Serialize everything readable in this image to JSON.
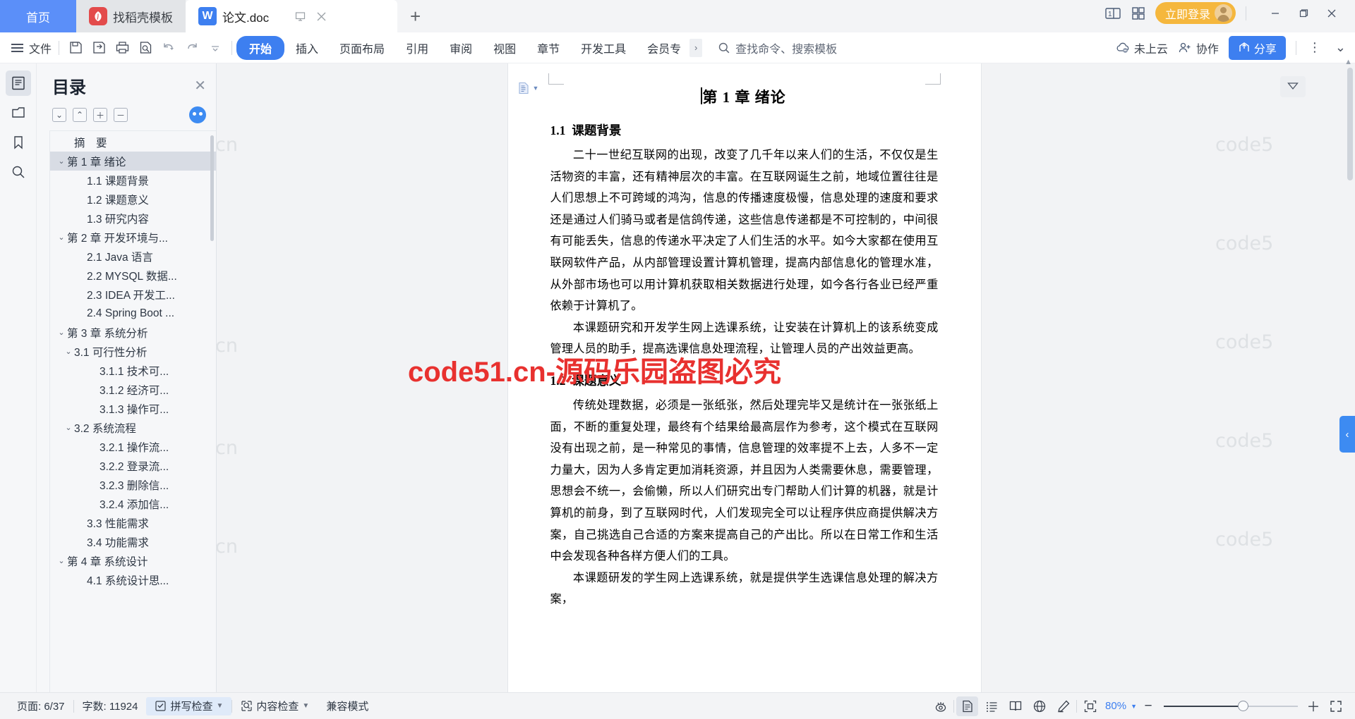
{
  "titlebar": {
    "tabs": [
      {
        "label": "首页",
        "icon": "home-tab",
        "type": "home"
      },
      {
        "label": "找稻壳模板",
        "icon": "docer-icon",
        "type": "template"
      },
      {
        "label": "论文.doc",
        "icon": "wps-writer-icon",
        "type": "document"
      }
    ],
    "new_tab": "+",
    "login_label": "立即登录",
    "icons": [
      "split-screen-icon",
      "app-grid-icon",
      "minimize-icon",
      "maximize-icon",
      "close-icon"
    ]
  },
  "ribbon": {
    "file_label": "文件",
    "quick_access": [
      "save-icon",
      "save-as-cloud-icon",
      "print-icon",
      "print-preview-icon",
      "undo-icon",
      "redo-icon",
      "customize-qat-icon"
    ],
    "tabs": [
      {
        "label": "开始",
        "active": true
      },
      {
        "label": "插入",
        "active": false
      },
      {
        "label": "页面布局",
        "active": false
      },
      {
        "label": "引用",
        "active": false
      },
      {
        "label": "审阅",
        "active": false
      },
      {
        "label": "视图",
        "active": false
      },
      {
        "label": "章节",
        "active": false
      },
      {
        "label": "开发工具",
        "active": false
      },
      {
        "label": "会员专",
        "active": false
      }
    ],
    "more_tabs": "›",
    "search_placeholder": "查找命令、搜索模板",
    "cloud_status": "未上云",
    "collab_label": "协作",
    "share_label": "分享",
    "overflow": "⋮",
    "collapse": "⌄"
  },
  "rail": {
    "items": [
      {
        "name": "outline-panel",
        "icon": "document-outline-icon",
        "active": true
      },
      {
        "name": "file-panel",
        "icon": "folder-icon",
        "active": false
      },
      {
        "name": "bookmark-panel",
        "icon": "bookmark-icon",
        "active": false
      },
      {
        "name": "search-panel",
        "icon": "search-icon",
        "active": false
      }
    ]
  },
  "outline": {
    "title": "目录",
    "close": "✕",
    "tools": [
      {
        "name": "expand-all",
        "glyph": "⌄"
      },
      {
        "name": "collapse-all",
        "glyph": "⌃"
      },
      {
        "name": "increase-level",
        "glyph": "＋"
      },
      {
        "name": "decrease-level",
        "glyph": "－"
      }
    ],
    "items": [
      {
        "label": "摘　要",
        "indent": 1,
        "caret": "",
        "selected": false
      },
      {
        "label": "第 1 章 绪论",
        "indent": 0,
        "caret": "⌄",
        "selected": true
      },
      {
        "label": "1.1 课题背景",
        "indent": 2,
        "caret": "",
        "selected": false
      },
      {
        "label": "1.2 课题意义",
        "indent": 2,
        "caret": "",
        "selected": false
      },
      {
        "label": "1.3 研究内容",
        "indent": 2,
        "caret": "",
        "selected": false
      },
      {
        "label": "第 2 章 开发环境与...",
        "indent": 0,
        "caret": "⌄",
        "selected": false
      },
      {
        "label": "2.1 Java 语言",
        "indent": 2,
        "caret": "",
        "selected": false
      },
      {
        "label": "2.2 MYSQL 数据...",
        "indent": 2,
        "caret": "",
        "selected": false
      },
      {
        "label": "2.3 IDEA 开发工...",
        "indent": 2,
        "caret": "",
        "selected": false
      },
      {
        "label": "2.4 Spring Boot ...",
        "indent": 2,
        "caret": "",
        "selected": false
      },
      {
        "label": "第 3 章 系统分析",
        "indent": 0,
        "caret": "⌄",
        "selected": false
      },
      {
        "label": "3.1 可行性分析",
        "indent": 1,
        "caret": "⌄",
        "selected": false
      },
      {
        "label": "3.1.1 技术可...",
        "indent": 3,
        "caret": "",
        "selected": false
      },
      {
        "label": "3.1.2 经济可...",
        "indent": 3,
        "caret": "",
        "selected": false
      },
      {
        "label": "3.1.3 操作可...",
        "indent": 3,
        "caret": "",
        "selected": false
      },
      {
        "label": "3.2 系统流程",
        "indent": 1,
        "caret": "⌄",
        "selected": false
      },
      {
        "label": "3.2.1 操作流...",
        "indent": 3,
        "caret": "",
        "selected": false
      },
      {
        "label": "3.2.2 登录流...",
        "indent": 3,
        "caret": "",
        "selected": false
      },
      {
        "label": "3.2.3 删除信...",
        "indent": 3,
        "caret": "",
        "selected": false
      },
      {
        "label": "3.2.4 添加信...",
        "indent": 3,
        "caret": "",
        "selected": false
      },
      {
        "label": "3.3 性能需求",
        "indent": 2,
        "caret": "",
        "selected": false
      },
      {
        "label": "3.4 功能需求",
        "indent": 2,
        "caret": "",
        "selected": false
      },
      {
        "label": "第 4 章 系统设计",
        "indent": 0,
        "caret": "⌄",
        "selected": false
      },
      {
        "label": "4.1 系统设计思...",
        "indent": 2,
        "caret": "",
        "selected": false
      }
    ]
  },
  "document": {
    "chapter_title": "第 1 章 绪论",
    "sections": [
      {
        "heading_num": "1.1",
        "heading_text": "课题背景",
        "paragraphs": [
          "二十一世纪互联网的出现，改变了几千年以来人们的生活，不仅仅是生活物资的丰富，还有精神层次的丰富。在互联网诞生之前，地域位置往往是人们思想上不可跨域的鸿沟，信息的传播速度极慢，信息处理的速度和要求还是通过人们骑马或者是信鸽传递，这些信息传递都是不可控制的，中间很有可能丢失，信息的传递水平决定了人们生活的水平。如今大家都在使用互联网软件产品，从内部管理设置计算机管理，提高内部信息化的管理水准，从外部市场也可以用计算机获取相关数据进行处理，如今各行各业已经严重依赖于计算机了。",
          "本课题研究和开发学生网上选课系统，让安装在计算机上的该系统变成管理人员的助手，提高选课信息处理流程，让管理人员的产出效益更高。"
        ]
      },
      {
        "heading_num": "1.2",
        "heading_text": "课题意义",
        "paragraphs": [
          "传统处理数据，必须是一张纸张，然后处理完毕又是统计在一张张纸上面，不断的重复处理，最终有个结果给最高层作为参考，这个模式在互联网没有出现之前，是一种常见的事情，信息管理的效率提不上去，人多不一定力量大，因为人多肯定更加消耗资源，并且因为人类需要休息，需要管理，思想会不统一，会偷懒，所以人们研究出专门帮助人们计算的机器，就是计算机的前身，到了互联网时代，人们发现完全可以让程序供应商提供解决方案，自己挑选自己合适的方案来提高自己的产出比。所以在日常工作和生活中会发现各种各样方便人们的工具。",
          "本课题研发的学生网上选课系统，就是提供学生选课信息处理的解决方案，"
        ]
      }
    ]
  },
  "watermarks": {
    "text": "code51.cn",
    "red_banner": "code51.cn-源码乐园盗图必究",
    "red_color": "#e8312f"
  },
  "statusbar": {
    "page_label": "页面: 6/37",
    "word_count_label": "字数: 11924",
    "spell_check": "拼写检查",
    "content_check": "内容检查",
    "compat_mode": "兼容模式",
    "view_icons": [
      {
        "name": "focus-read-icon",
        "active": false
      },
      {
        "name": "page-view-icon",
        "active": true
      },
      {
        "name": "outline-view-icon",
        "active": false
      },
      {
        "name": "reading-layout-icon",
        "active": false
      },
      {
        "name": "web-layout-icon",
        "active": false
      },
      {
        "name": "annotate-icon",
        "active": false
      }
    ],
    "fit-icon": "fit-page-icon",
    "zoom_value": "80%",
    "zoom_out": "−",
    "zoom_in": "＋",
    "fullscreen": "fullscreen-icon"
  }
}
